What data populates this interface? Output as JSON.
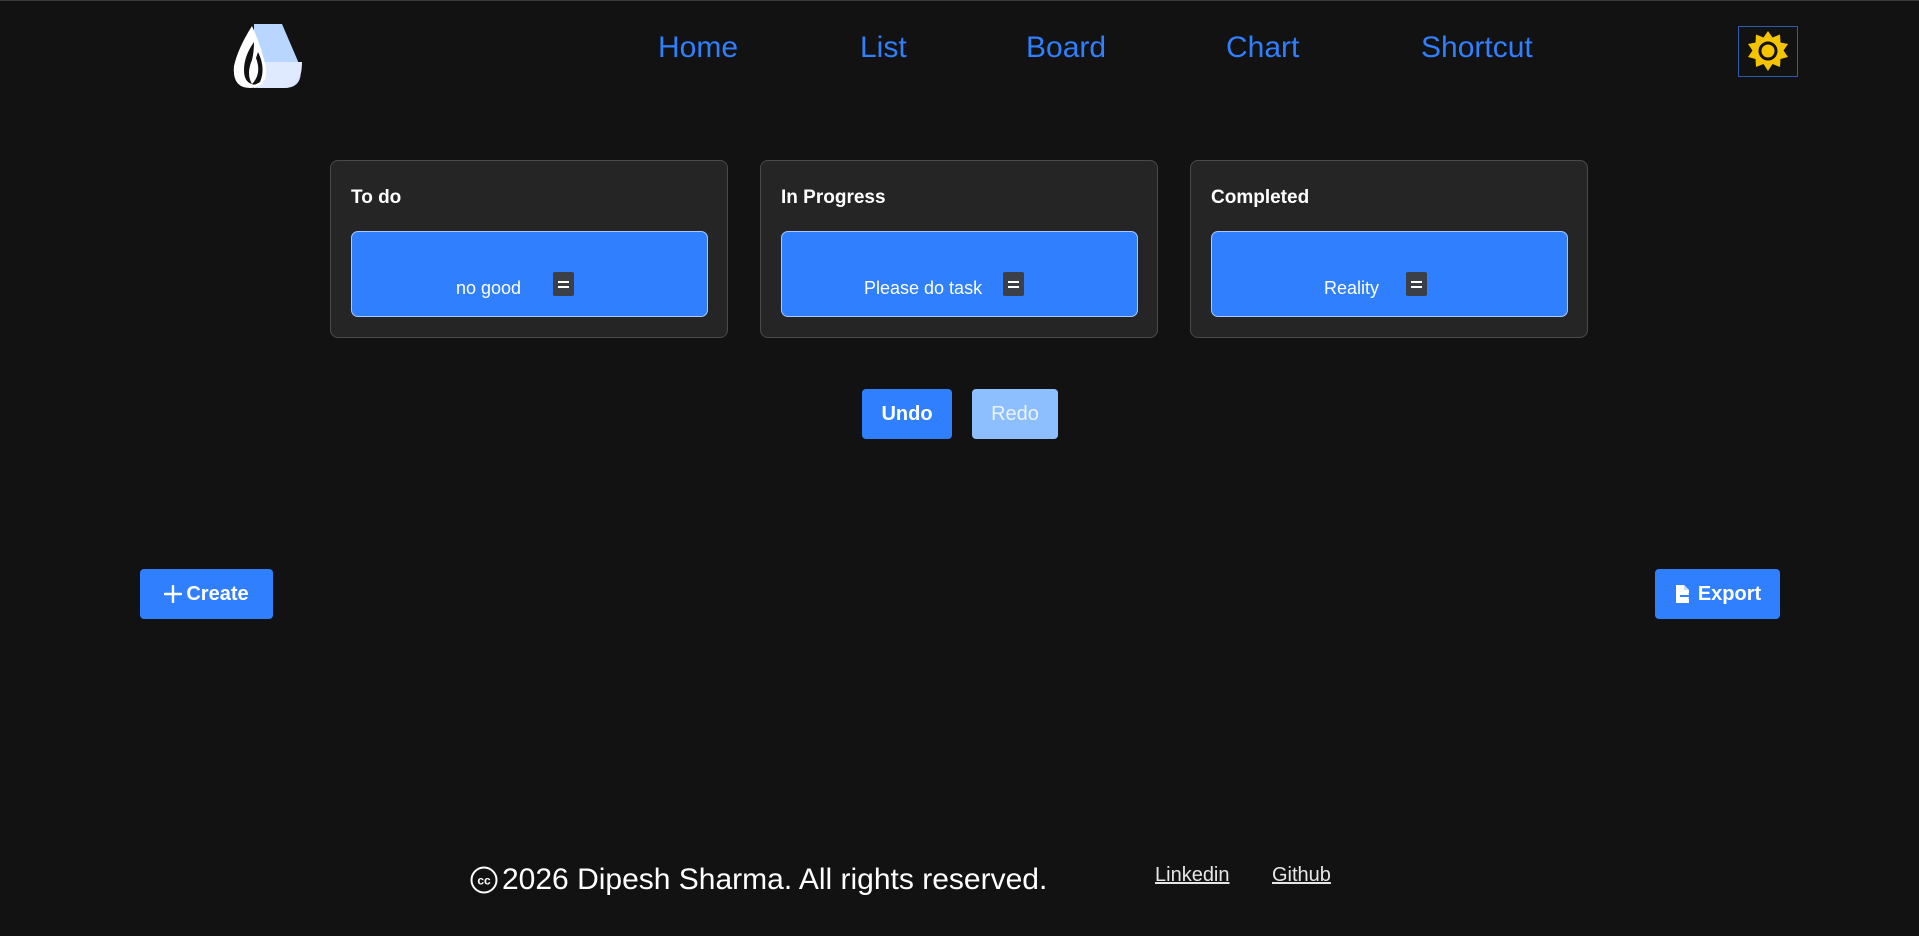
{
  "nav": {
    "items": [
      {
        "label": "Home"
      },
      {
        "label": "List"
      },
      {
        "label": "Board"
      },
      {
        "label": "Chart"
      },
      {
        "label": "Shortcut"
      }
    ]
  },
  "board": {
    "columns": [
      {
        "title": "To do",
        "card": "no good"
      },
      {
        "title": "In Progress",
        "card": "Please do task"
      },
      {
        "title": "Completed",
        "card": "Reality"
      }
    ]
  },
  "actions": {
    "undo": "Undo",
    "redo": "Redo",
    "create": "Create",
    "export": "Export"
  },
  "footer": {
    "copyright": "2026 Dipesh Sharma. All rights reserved.",
    "links": [
      {
        "label": "Linkedin"
      },
      {
        "label": "Github"
      }
    ]
  },
  "colors": {
    "accent": "#2f7fff",
    "background": "#121212",
    "sun": "#f5c400"
  },
  "icons": {
    "logo": "drop-logo-icon",
    "theme": "sun-icon",
    "create": "plus-icon",
    "export": "file-export-icon",
    "footer": "copyright-cc-icon",
    "card_handle": "drag-handle-icon"
  }
}
